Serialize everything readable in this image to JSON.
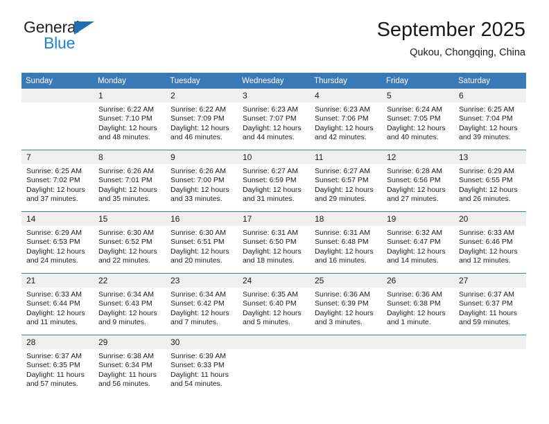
{
  "brand": {
    "name_top": "General",
    "name_bottom": "Blue",
    "triangle_color": "#1f6fb5",
    "blue_color": "#1f82d1"
  },
  "header": {
    "title": "September 2025",
    "location": "Qukou, Chongqing, China"
  },
  "colors": {
    "header_bar": "#3a79b8",
    "daynum_band": "#efefef",
    "row_separator": "#3a79b8",
    "text": "#1a1a1a"
  },
  "weekdays": [
    "Sunday",
    "Monday",
    "Tuesday",
    "Wednesday",
    "Thursday",
    "Friday",
    "Saturday"
  ],
  "weeks": [
    [
      {
        "day": "",
        "lines": []
      },
      {
        "day": "1",
        "lines": [
          "Sunrise: 6:22 AM",
          "Sunset: 7:10 PM",
          "Daylight: 12 hours",
          "and 48 minutes."
        ]
      },
      {
        "day": "2",
        "lines": [
          "Sunrise: 6:22 AM",
          "Sunset: 7:09 PM",
          "Daylight: 12 hours",
          "and 46 minutes."
        ]
      },
      {
        "day": "3",
        "lines": [
          "Sunrise: 6:23 AM",
          "Sunset: 7:07 PM",
          "Daylight: 12 hours",
          "and 44 minutes."
        ]
      },
      {
        "day": "4",
        "lines": [
          "Sunrise: 6:23 AM",
          "Sunset: 7:06 PM",
          "Daylight: 12 hours",
          "and 42 minutes."
        ]
      },
      {
        "day": "5",
        "lines": [
          "Sunrise: 6:24 AM",
          "Sunset: 7:05 PM",
          "Daylight: 12 hours",
          "and 40 minutes."
        ]
      },
      {
        "day": "6",
        "lines": [
          "Sunrise: 6:25 AM",
          "Sunset: 7:04 PM",
          "Daylight: 12 hours",
          "and 39 minutes."
        ]
      }
    ],
    [
      {
        "day": "7",
        "lines": [
          "Sunrise: 6:25 AM",
          "Sunset: 7:02 PM",
          "Daylight: 12 hours",
          "and 37 minutes."
        ]
      },
      {
        "day": "8",
        "lines": [
          "Sunrise: 6:26 AM",
          "Sunset: 7:01 PM",
          "Daylight: 12 hours",
          "and 35 minutes."
        ]
      },
      {
        "day": "9",
        "lines": [
          "Sunrise: 6:26 AM",
          "Sunset: 7:00 PM",
          "Daylight: 12 hours",
          "and 33 minutes."
        ]
      },
      {
        "day": "10",
        "lines": [
          "Sunrise: 6:27 AM",
          "Sunset: 6:59 PM",
          "Daylight: 12 hours",
          "and 31 minutes."
        ]
      },
      {
        "day": "11",
        "lines": [
          "Sunrise: 6:27 AM",
          "Sunset: 6:57 PM",
          "Daylight: 12 hours",
          "and 29 minutes."
        ]
      },
      {
        "day": "12",
        "lines": [
          "Sunrise: 6:28 AM",
          "Sunset: 6:56 PM",
          "Daylight: 12 hours",
          "and 27 minutes."
        ]
      },
      {
        "day": "13",
        "lines": [
          "Sunrise: 6:29 AM",
          "Sunset: 6:55 PM",
          "Daylight: 12 hours",
          "and 26 minutes."
        ]
      }
    ],
    [
      {
        "day": "14",
        "lines": [
          "Sunrise: 6:29 AM",
          "Sunset: 6:53 PM",
          "Daylight: 12 hours",
          "and 24 minutes."
        ]
      },
      {
        "day": "15",
        "lines": [
          "Sunrise: 6:30 AM",
          "Sunset: 6:52 PM",
          "Daylight: 12 hours",
          "and 22 minutes."
        ]
      },
      {
        "day": "16",
        "lines": [
          "Sunrise: 6:30 AM",
          "Sunset: 6:51 PM",
          "Daylight: 12 hours",
          "and 20 minutes."
        ]
      },
      {
        "day": "17",
        "lines": [
          "Sunrise: 6:31 AM",
          "Sunset: 6:50 PM",
          "Daylight: 12 hours",
          "and 18 minutes."
        ]
      },
      {
        "day": "18",
        "lines": [
          "Sunrise: 6:31 AM",
          "Sunset: 6:48 PM",
          "Daylight: 12 hours",
          "and 16 minutes."
        ]
      },
      {
        "day": "19",
        "lines": [
          "Sunrise: 6:32 AM",
          "Sunset: 6:47 PM",
          "Daylight: 12 hours",
          "and 14 minutes."
        ]
      },
      {
        "day": "20",
        "lines": [
          "Sunrise: 6:33 AM",
          "Sunset: 6:46 PM",
          "Daylight: 12 hours",
          "and 12 minutes."
        ]
      }
    ],
    [
      {
        "day": "21",
        "lines": [
          "Sunrise: 6:33 AM",
          "Sunset: 6:44 PM",
          "Daylight: 12 hours",
          "and 11 minutes."
        ]
      },
      {
        "day": "22",
        "lines": [
          "Sunrise: 6:34 AM",
          "Sunset: 6:43 PM",
          "Daylight: 12 hours",
          "and 9 minutes."
        ]
      },
      {
        "day": "23",
        "lines": [
          "Sunrise: 6:34 AM",
          "Sunset: 6:42 PM",
          "Daylight: 12 hours",
          "and 7 minutes."
        ]
      },
      {
        "day": "24",
        "lines": [
          "Sunrise: 6:35 AM",
          "Sunset: 6:40 PM",
          "Daylight: 12 hours",
          "and 5 minutes."
        ]
      },
      {
        "day": "25",
        "lines": [
          "Sunrise: 6:36 AM",
          "Sunset: 6:39 PM",
          "Daylight: 12 hours",
          "and 3 minutes."
        ]
      },
      {
        "day": "26",
        "lines": [
          "Sunrise: 6:36 AM",
          "Sunset: 6:38 PM",
          "Daylight: 12 hours",
          "and 1 minute."
        ]
      },
      {
        "day": "27",
        "lines": [
          "Sunrise: 6:37 AM",
          "Sunset: 6:37 PM",
          "Daylight: 11 hours",
          "and 59 minutes."
        ]
      }
    ],
    [
      {
        "day": "28",
        "lines": [
          "Sunrise: 6:37 AM",
          "Sunset: 6:35 PM",
          "Daylight: 11 hours",
          "and 57 minutes."
        ]
      },
      {
        "day": "29",
        "lines": [
          "Sunrise: 6:38 AM",
          "Sunset: 6:34 PM",
          "Daylight: 11 hours",
          "and 56 minutes."
        ]
      },
      {
        "day": "30",
        "lines": [
          "Sunrise: 6:39 AM",
          "Sunset: 6:33 PM",
          "Daylight: 11 hours",
          "and 54 minutes."
        ]
      },
      {
        "day": "",
        "lines": []
      },
      {
        "day": "",
        "lines": []
      },
      {
        "day": "",
        "lines": []
      },
      {
        "day": "",
        "lines": []
      }
    ]
  ]
}
